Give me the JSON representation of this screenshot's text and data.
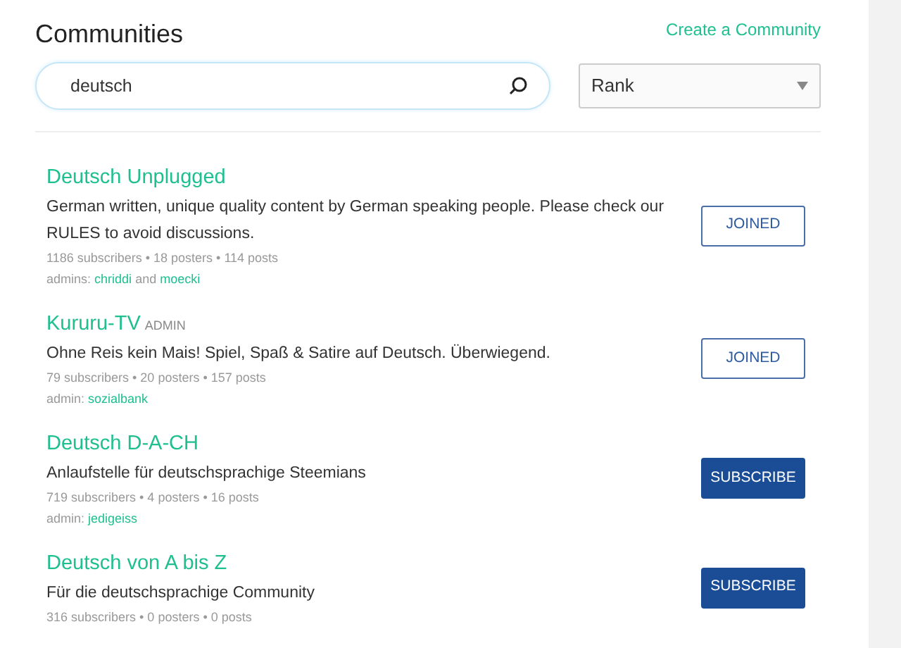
{
  "header": {
    "title": "Communities",
    "create_link": "Create a Community"
  },
  "search": {
    "value": "deutsch"
  },
  "sort": {
    "value": "Rank"
  },
  "communities": [
    {
      "name": "Deutsch Unplugged",
      "description": "German written, unique quality content by German speaking people. Please check our RULES to avoid discussions.",
      "stats": "1186 subscribers • 18 posters • 114 posts",
      "admin_label": "admins:",
      "admins": [
        "chriddi",
        "moecki"
      ],
      "joiner": "and",
      "joined": true,
      "button": "JOINED"
    },
    {
      "name": "Kururu-TV",
      "badge": "ADMIN",
      "description": "Ohne Reis kein Mais! Spiel, Spaß & Satire auf Deutsch. Überwiegend.",
      "stats": "79 subscribers • 20 posters • 157 posts",
      "admin_label": "admin:",
      "admins": [
        "sozialbank"
      ],
      "joined": true,
      "button": "JOINED"
    },
    {
      "name": "Deutsch D-A-CH",
      "description": "Anlaufstelle für deutschsprachige Steemians",
      "stats": "719 subscribers • 4 posters • 16 posts",
      "admin_label": "admin:",
      "admins": [
        "jedigeiss"
      ],
      "joined": false,
      "button": "SUBSCRIBE"
    },
    {
      "name": "Deutsch von A bis Z",
      "description": "Für die deutschsprachige Community",
      "stats": "316 subscribers • 0 posters • 0 posts",
      "joined": false,
      "button": "SUBSCRIBE"
    }
  ]
}
